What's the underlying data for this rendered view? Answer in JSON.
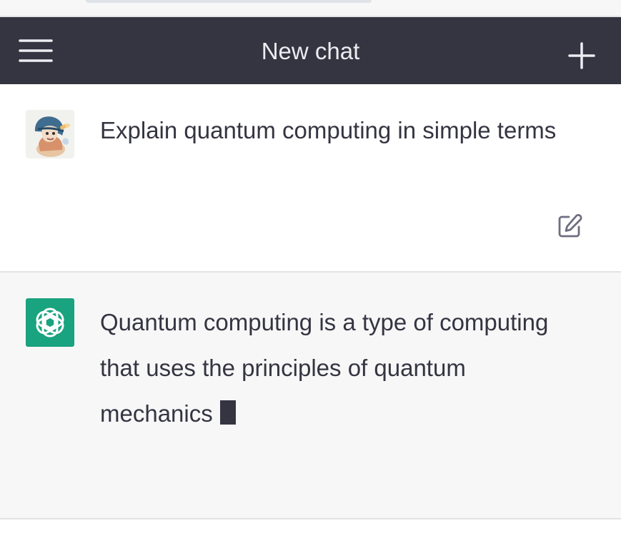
{
  "header": {
    "title": "New chat",
    "menu_icon": "hamburger-menu-icon",
    "new_chat_icon": "plus-icon"
  },
  "messages": [
    {
      "role": "user",
      "text": "Explain quantum computing in simple terms",
      "avatar": "user-avatar-illustration",
      "action_icon": "edit-icon"
    },
    {
      "role": "assistant",
      "text": "Quantum computing is a type of computing that uses the principles of quantum mechanics",
      "avatar": "openai-logo-icon",
      "streaming": true
    }
  ],
  "colors": {
    "header_bg": "#343541",
    "assistant_bg": "#f7f7f8",
    "assistant_avatar": "#19a37e",
    "text": "#343541"
  }
}
